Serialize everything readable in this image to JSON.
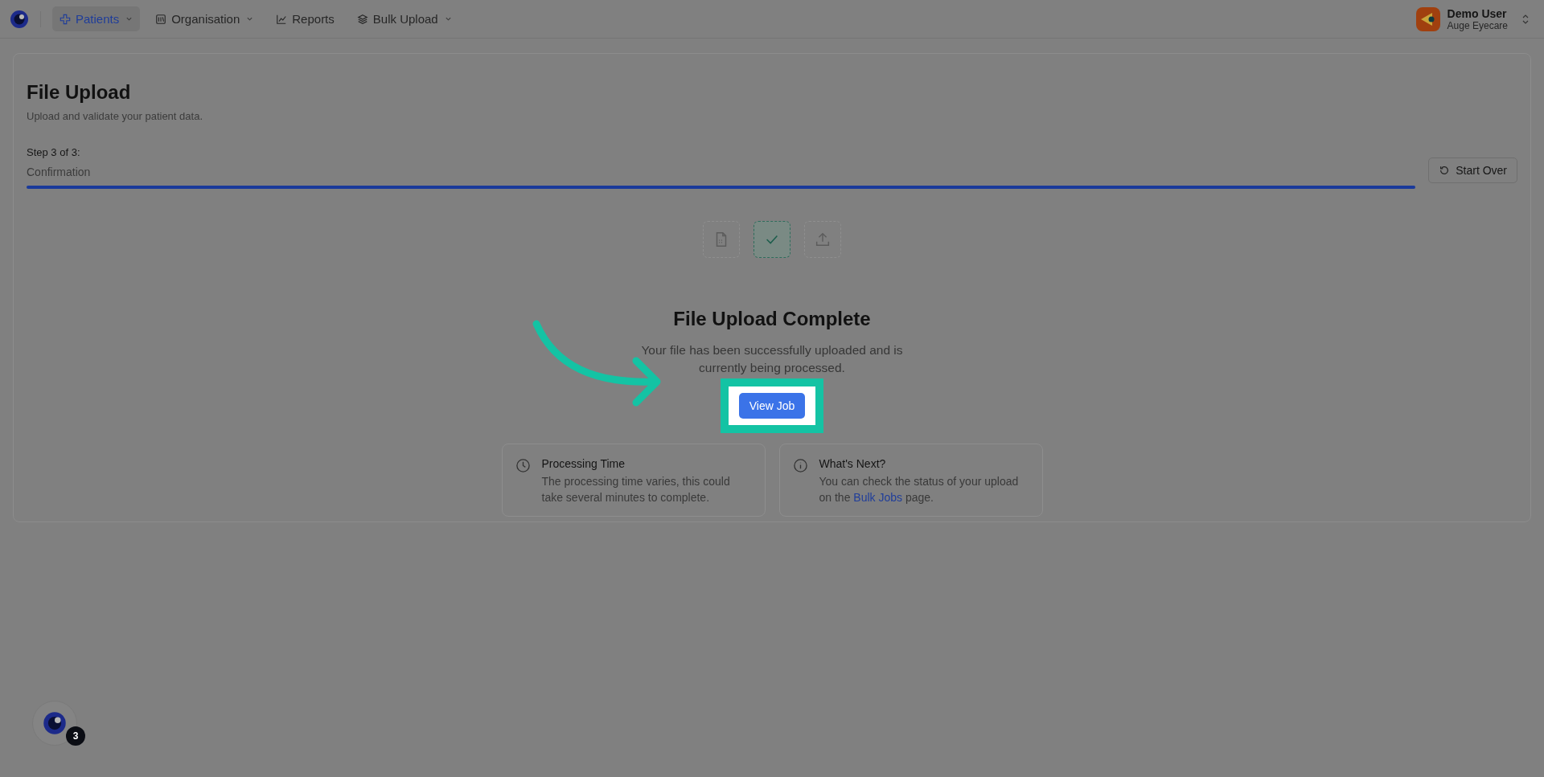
{
  "nav": {
    "items": [
      {
        "label": "Patients",
        "kind": "cross",
        "has_menu": true,
        "selected": true
      },
      {
        "label": "Organisation",
        "kind": "building",
        "has_menu": true,
        "selected": false
      },
      {
        "label": "Reports",
        "kind": "chart",
        "has_menu": false,
        "selected": false
      },
      {
        "label": "Bulk Upload",
        "kind": "layers",
        "has_menu": true,
        "selected": false
      }
    ],
    "user": {
      "name": "Demo User",
      "org": "Auge Eyecare"
    }
  },
  "page": {
    "title": "File Upload",
    "subtitle": "Upload and validate your patient data.",
    "step": "Step 3 of 3:",
    "step_name": "Confirmation",
    "progress": {
      "level": 1
    },
    "start_over": "Start Over"
  },
  "steps": [
    {
      "kind": "file",
      "selected": false
    },
    {
      "kind": "check",
      "selected": true
    },
    {
      "kind": "upload",
      "selected": false
    }
  ],
  "complete": {
    "title": "File Upload Complete",
    "text": "Your file has been successfully uploaded and is currently being processed.",
    "button": "View Job"
  },
  "info_cards": [
    {
      "kind": "clock",
      "title": "Processing Time",
      "text": "The processing time varies, this could take several minutes to complete."
    },
    {
      "kind": "info",
      "title": "What's Next?",
      "text_before": "You can check the status of your upload on the",
      "link": "Bulk Jobs",
      "text_after": "page."
    }
  ],
  "help": {
    "badge": "3"
  }
}
